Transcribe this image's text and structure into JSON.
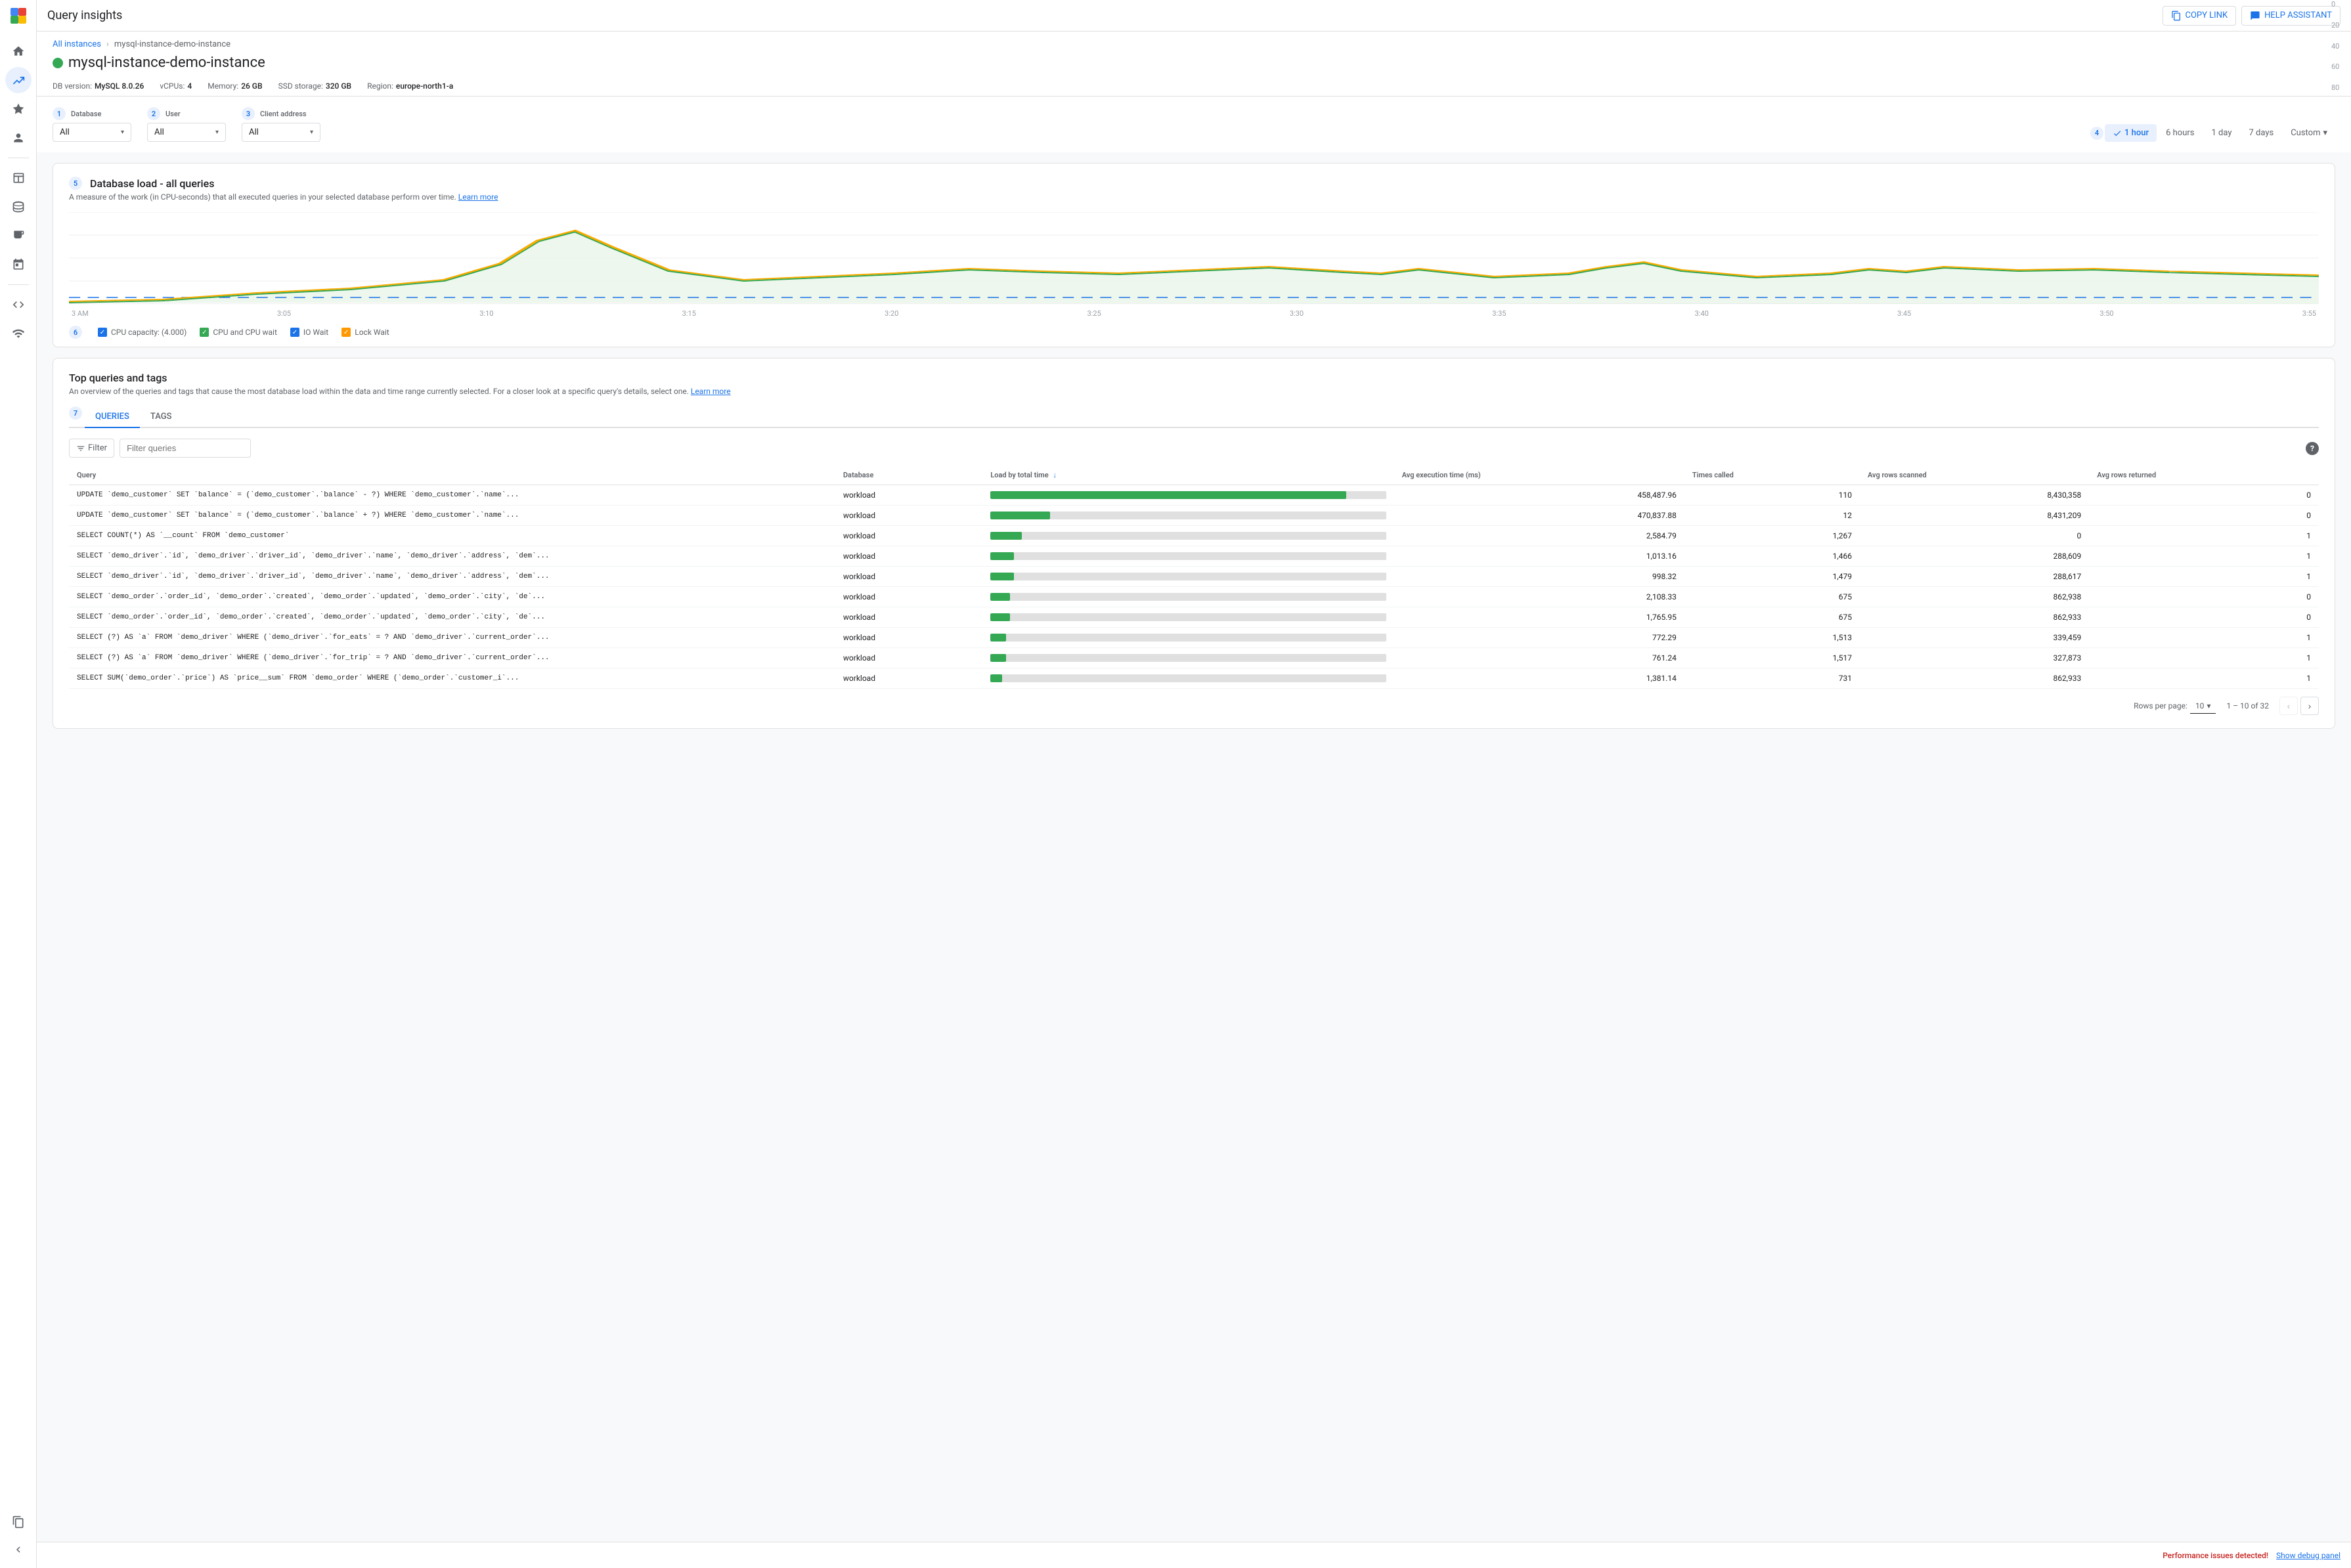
{
  "app": {
    "title": "Query insights"
  },
  "topbar": {
    "title": "Query insights",
    "copy_link_label": "COPY LINK",
    "help_label": "HELP ASSISTANT"
  },
  "breadcrumb": {
    "all_instances": "All instances",
    "current": "mysql-instance-demo-instance"
  },
  "instance": {
    "name": "mysql-instance-demo-instance",
    "status": "running",
    "db_version_label": "DB version:",
    "db_version": "MySQL 8.0.26",
    "vcpu_label": "vCPUs:",
    "vcpu": "4",
    "memory_label": "Memory:",
    "memory": "26 GB",
    "ssd_label": "SSD storage:",
    "ssd": "320 GB",
    "region_label": "Region:",
    "region": "europe-north1-a"
  },
  "filters": {
    "step1": "1",
    "step2": "2",
    "step3": "3",
    "database": {
      "label": "Database",
      "value": "All"
    },
    "user": {
      "label": "User",
      "value": "All"
    },
    "client_address": {
      "label": "Client address",
      "value": "All"
    },
    "step4": "4",
    "time_options": [
      "1 hour",
      "6 hours",
      "1 day",
      "7 days",
      "Custom"
    ],
    "active_time": "1 hour",
    "time_1h": "1 hour",
    "time_6h": "6 hours",
    "time_1d": "1 day",
    "time_7d": "7 days",
    "time_custom": "Custom"
  },
  "chart": {
    "title": "Database load - all queries",
    "step5": "5",
    "description": "A measure of the work (in CPU-seconds) that all executed queries in your selected database perform over time.",
    "learn_more": "Learn more",
    "y_labels": [
      "0",
      "20",
      "40",
      "60",
      "80"
    ],
    "x_labels": [
      "3 AM",
      "3:05",
      "3:10",
      "3:15",
      "3:20",
      "3:25",
      "3:30",
      "3:35",
      "3:40",
      "3:45",
      "3:50",
      "3:55"
    ],
    "legend": {
      "step6": "6",
      "cpu_capacity": "CPU capacity: (4.000)",
      "cpu_and_cpu_wait": "CPU and CPU wait",
      "io_wait": "IO Wait",
      "lock_wait": "Lock Wait"
    }
  },
  "queries_section": {
    "title": "Top queries and tags",
    "description": "An overview of the queries and tags that cause the most database load within the data and time range currently selected. For a closer look at a specific query's details, select one.",
    "learn_more": "Learn more",
    "step7": "7",
    "tabs": {
      "queries": "QUERIES",
      "tags": "TAGS"
    },
    "filter": {
      "label": "Filter",
      "placeholder": "Filter queries"
    },
    "columns": {
      "query": "Query",
      "database": "Database",
      "load_by_total_time": "Load by total time",
      "avg_execution_time": "Avg execution time (ms)",
      "times_called": "Times called",
      "avg_rows_scanned": "Avg rows scanned",
      "avg_rows_returned": "Avg rows returned"
    },
    "rows": [
      {
        "query": "UPDATE `demo_customer` SET `balance` = (`demo_customer`.`balance` - ?) WHERE `demo_customer`.`name`...",
        "database": "workload",
        "load_bar": 90,
        "avg_execution_time": "458,487.96",
        "times_called": "110",
        "avg_rows_scanned": "8,430,358",
        "avg_rows_returned": "0"
      },
      {
        "query": "UPDATE `demo_customer` SET `balance` = (`demo_customer`.`balance` + ?) WHERE `demo_customer`.`name`...",
        "database": "workload",
        "load_bar": 15,
        "avg_execution_time": "470,837.88",
        "times_called": "12",
        "avg_rows_scanned": "8,431,209",
        "avg_rows_returned": "0"
      },
      {
        "query": "SELECT COUNT(*) AS `__count` FROM `demo_customer`",
        "database": "workload",
        "load_bar": 8,
        "avg_execution_time": "2,584.79",
        "times_called": "1,267",
        "avg_rows_scanned": "0",
        "avg_rows_returned": "1"
      },
      {
        "query": "SELECT `demo_driver`.`id`, `demo_driver`.`driver_id`, `demo_driver`.`name`, `demo_driver`.`address`, `dem`...",
        "database": "workload",
        "load_bar": 6,
        "avg_execution_time": "1,013.16",
        "times_called": "1,466",
        "avg_rows_scanned": "288,609",
        "avg_rows_returned": "1"
      },
      {
        "query": "SELECT `demo_driver`.`id`, `demo_driver`.`driver_id`, `demo_driver`.`name`, `demo_driver`.`address`, `dem`...",
        "database": "workload",
        "load_bar": 6,
        "avg_execution_time": "998.32",
        "times_called": "1,479",
        "avg_rows_scanned": "288,617",
        "avg_rows_returned": "1"
      },
      {
        "query": "SELECT `demo_order`.`order_id`, `demo_order`.`created`, `demo_order`.`updated`, `demo_order`.`city`, `de`...",
        "database": "workload",
        "load_bar": 5,
        "avg_execution_time": "2,108.33",
        "times_called": "675",
        "avg_rows_scanned": "862,938",
        "avg_rows_returned": "0"
      },
      {
        "query": "SELECT `demo_order`.`order_id`, `demo_order`.`created`, `demo_order`.`updated`, `demo_order`.`city`, `de`...",
        "database": "workload",
        "load_bar": 5,
        "avg_execution_time": "1,765.95",
        "times_called": "675",
        "avg_rows_scanned": "862,933",
        "avg_rows_returned": "0"
      },
      {
        "query": "SELECT (?) AS `a` FROM `demo_driver` WHERE (`demo_driver`.`for_eats` = ? AND `demo_driver`.`current_order`...",
        "database": "workload",
        "load_bar": 4,
        "avg_execution_time": "772.29",
        "times_called": "1,513",
        "avg_rows_scanned": "339,459",
        "avg_rows_returned": "1"
      },
      {
        "query": "SELECT (?) AS `a` FROM `demo_driver` WHERE (`demo_driver`.`for_trip` = ? AND `demo_driver`.`current_order`...",
        "database": "workload",
        "load_bar": 4,
        "avg_execution_time": "761.24",
        "times_called": "1,517",
        "avg_rows_scanned": "327,873",
        "avg_rows_returned": "1"
      },
      {
        "query": "SELECT SUM(`demo_order`.`price`) AS `price__sum` FROM `demo_order` WHERE (`demo_order`.`customer_i`...",
        "database": "workload",
        "load_bar": 3,
        "avg_execution_time": "1,381.14",
        "times_called": "731",
        "avg_rows_scanned": "862,933",
        "avg_rows_returned": "1"
      }
    ],
    "footer": {
      "rows_per_page": "Rows per page:",
      "rows_per_page_value": "10",
      "pagination": "1 – 10 of 32"
    }
  },
  "bottom_bar": {
    "perf_alert": "Performance issues detected!",
    "debug_link": "Show debug panel"
  },
  "sidebar": {
    "icons": [
      "≡",
      "◉",
      "⚡",
      "→",
      "👤",
      "▦",
      "☰",
      "↕",
      "≡",
      "⊞",
      "☰",
      "⊕",
      "≡"
    ]
  }
}
